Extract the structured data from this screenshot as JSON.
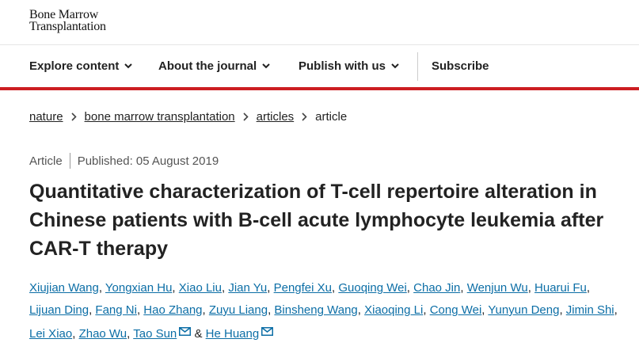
{
  "journal": {
    "logo_line1": "Bone Marrow",
    "logo_line2": "Transplantation"
  },
  "nav": {
    "items": [
      {
        "label": "Explore content"
      },
      {
        "label": "About the journal"
      },
      {
        "label": "Publish with us"
      }
    ],
    "subscribe": "Subscribe"
  },
  "breadcrumb": [
    "nature",
    "bone marrow transplantation",
    "articles",
    "article"
  ],
  "article": {
    "type": "Article",
    "published": "Published: 05 August 2019",
    "title": "Quantitative characterization of T-cell repertoire alteration in Chinese patients with B-cell acute lymphocyte leukemia after CAR-T therapy"
  },
  "authors": [
    "Xiujian Wang",
    "Yongxian Hu",
    "Xiao Liu",
    "Jian Yu",
    "Pengfei Xu",
    "Guoqing Wei",
    "Chao Jin",
    "Wenjun Wu",
    "Huarui Fu",
    "Lijuan Ding",
    "Fang Ni",
    "Hao Zhang",
    "Zuyu Liang",
    "Binsheng Wang",
    "Xiaoqing Li",
    "Cong Wei",
    "Yunyun Deng",
    "Jimin Shi",
    "Lei Xiao",
    "Zhao Wu",
    "Tao Sun",
    "He Huang"
  ],
  "authors_and": "&",
  "icons": {
    "nav_chevron": "chevron-down-icon",
    "crumb_sep": "chevron-right-icon",
    "email": "mail-icon"
  },
  "colors": {
    "accent_red": "#cc1e22",
    "link_blue": "#0c6ea6"
  }
}
